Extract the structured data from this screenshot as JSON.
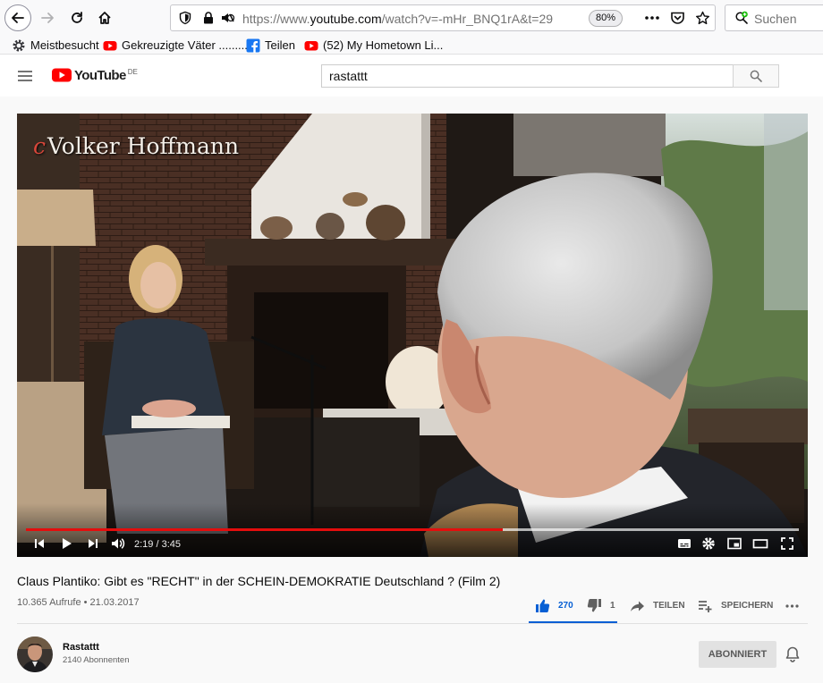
{
  "browser": {
    "url_prefix": "https://www.",
    "url_host": "youtube.com",
    "url_path": "/watch?v=-mHr_BNQ1rA&t=29",
    "zoom": "80%",
    "search_placeholder": "Suchen",
    "bookmarks": [
      {
        "label": "Meistbesucht",
        "icon": "gear-icon"
      },
      {
        "label": "Gekreuzigte Väter ..........",
        "icon": "youtube-icon"
      },
      {
        "label": "Teilen",
        "icon": "facebook-icon"
      },
      {
        "label": "(52) My Hometown Li...",
        "icon": "youtube-icon"
      }
    ]
  },
  "youtube": {
    "logo_text": "YouTube",
    "region": "DE",
    "search_query": "rastattt"
  },
  "player": {
    "watermark_prefix": "c",
    "watermark": "Volker Hoffmann",
    "time": "2:19 / 3:45",
    "progress_fraction": 0.617
  },
  "video": {
    "title": "Claus Plantiko: Gibt es \"RECHT\" in der SCHEIN-DEMOKRATIE Deutschland ? (Film 2)",
    "views_date": "10.365 Aufrufe • 21.03.2017",
    "likes": "270",
    "dislikes": "1",
    "share_label": "TEILEN",
    "save_label": "SPEICHERN"
  },
  "channel": {
    "name": "Rastattt",
    "subscribers": "2140 Abonnenten",
    "subscribe_label": "ABONNIERT"
  },
  "colors": {
    "youtube_red": "#ff0000",
    "progress_red": "#e40d0d",
    "like_blue": "#065fd4"
  }
}
